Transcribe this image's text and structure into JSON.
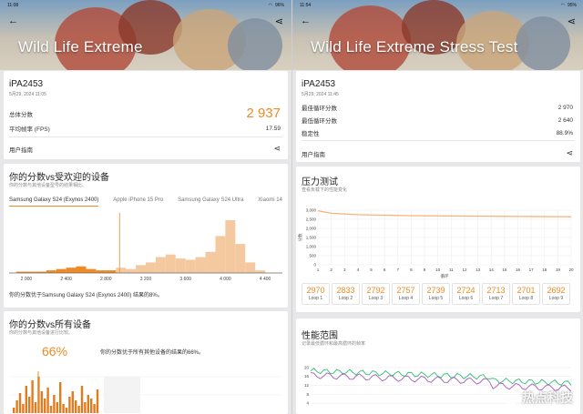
{
  "left": {
    "status": {
      "time": "11:08",
      "battery": "96%"
    },
    "banner_title": "Wild Life Extreme",
    "device": {
      "name": "iPA2453",
      "date": "5月29, 2024 11:05"
    },
    "total_label": "总体分数",
    "total_value": "2 937",
    "fps_label": "平均帧率 (FPS)",
    "fps_value": "17.59",
    "user_guide": "用户指南",
    "compare": {
      "title": "你的分数vs受欢迎的设备",
      "subtitle": "你的分数与其他设备型号的结果相比。",
      "tabs": [
        "Samsung Galaxy S24 (Exynos 2400)",
        "Apple iPhone 15 Pro",
        "Samsung Galaxy S24 Ultra",
        "Xiaomi 14"
      ],
      "x_ticks": [
        "2 000",
        "2 400",
        "2 800",
        "3 200",
        "3 600",
        "4 000",
        "4 400"
      ],
      "note": "你的分数优于Samsung Galaxy S24 (Exynos 2400) 结果的8%。"
    },
    "all_devices": {
      "title": "你的分数vs所有设备",
      "subtitle": "你的分数与其他设备进行比较。",
      "percent": "66%",
      "note": "你的分数优于所有其他设备的结果的66%。"
    }
  },
  "right": {
    "status": {
      "time": "11:54",
      "battery": "95%"
    },
    "banner_title": "Wild Life Extreme Stress Test",
    "device": {
      "name": "iPA2453",
      "date": "5月29, 2024 11:45"
    },
    "best_label": "最佳循环分数",
    "best_value": "2 970",
    "worst_label": "最低循环分数",
    "worst_value": "2 640",
    "stability_label": "稳定性",
    "stability_value": "88.9%",
    "user_guide": "用户指南",
    "stress": {
      "title": "压力测试",
      "subtitle": "查看负载下的性能变化",
      "y_label": "分数",
      "x_label": "循环",
      "y_ticks": [
        "3,000",
        "2,500",
        "2,000",
        "1,500",
        "1,000",
        "500",
        "0"
      ]
    },
    "loops": [
      {
        "value": "2970",
        "label": "Loop 1"
      },
      {
        "value": "2833",
        "label": "Loop 2"
      },
      {
        "value": "2792",
        "label": "Loop 3"
      },
      {
        "value": "2757",
        "label": "Loop 4"
      },
      {
        "value": "2739",
        "label": "Loop 5"
      },
      {
        "value": "2724",
        "label": "Loop 6"
      },
      {
        "value": "2713",
        "label": "Loop 7"
      },
      {
        "value": "2701",
        "label": "Loop 8"
      },
      {
        "value": "2692",
        "label": "Loop 9"
      }
    ],
    "perf": {
      "title": "性能范围",
      "subtitle": "记录最低循环和最高循环的帧率",
      "y_ticks": [
        "20",
        "16",
        "12",
        "8",
        "4"
      ]
    },
    "watermark": "热点科技"
  },
  "chart_data": [
    {
      "type": "line",
      "title": "压力测试",
      "xlabel": "循环",
      "ylabel": "分数",
      "x": [
        1,
        2,
        3,
        4,
        5,
        6,
        7,
        8,
        9,
        10,
        11,
        12,
        13,
        14,
        15,
        16,
        17,
        18,
        19,
        20
      ],
      "series": [
        {
          "values": [
            2970,
            2833,
            2792,
            2757,
            2739,
            2724,
            2713,
            2701,
            2692,
            2688,
            2680,
            2675,
            2670,
            2668,
            2660,
            2655,
            2652,
            2648,
            2644,
            2640
          ]
        }
      ],
      "ylim": [
        0,
        3000
      ],
      "grid": true
    },
    {
      "type": "area",
      "title": "你的分数vs受欢迎的设备",
      "xlim": [
        1900,
        4500
      ],
      "x": [
        1950,
        2050,
        2150,
        2250,
        2350,
        2450,
        2550,
        2650,
        2750,
        2850,
        2950,
        3050,
        3150,
        3250,
        3350,
        3450,
        3550,
        3650,
        3750,
        3850,
        3950,
        4050,
        4150,
        4250,
        4350
      ],
      "values": [
        1,
        1,
        1,
        2,
        3,
        4,
        5,
        3,
        2,
        2,
        4,
        3,
        6,
        8,
        12,
        14,
        11,
        10,
        12,
        16,
        28,
        40,
        22,
        8,
        2
      ]
    }
  ],
  "colors": {
    "accent": "#f08a24",
    "histogram": "#f5c9a0",
    "stress_line": "#f5b47a",
    "green": "#2fbf71",
    "purple": "#a45ab8"
  }
}
